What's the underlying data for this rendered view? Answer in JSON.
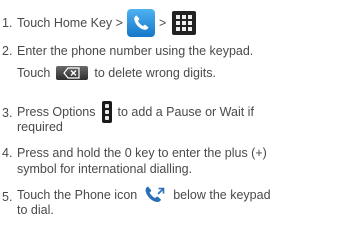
{
  "steps": [
    {
      "number": "1.",
      "prefix": "Touch Home Key >",
      "separator": ">",
      "icons": [
        "phone-app-icon",
        "app-grid-icon"
      ]
    },
    {
      "number": "2.",
      "line1": "Enter the phone number using the keypad.",
      "line2_prefix": "Touch",
      "line2_suffix": "to delete wrong digits.",
      "icons": [
        "backspace-delete-icon"
      ]
    },
    {
      "number": "3.",
      "line1_prefix": "Press Options",
      "line1_suffix": "to add a Pause or Wait if",
      "line2": "required",
      "icons": [
        "options-menu-icon"
      ]
    },
    {
      "number": "4.",
      "line1": "Press and hold the 0 key to enter the plus (+)",
      "line2": "symbol for international dialling."
    },
    {
      "number": "5.",
      "line1_prefix": "Touch the Phone icon",
      "line1_suffix": "below the keypad",
      "line2": "to dial.",
      "icons": [
        "phone-call-icon"
      ]
    }
  ],
  "colors": {
    "text": "#4a4a4a",
    "phone_tile": "#2b8fe0"
  }
}
